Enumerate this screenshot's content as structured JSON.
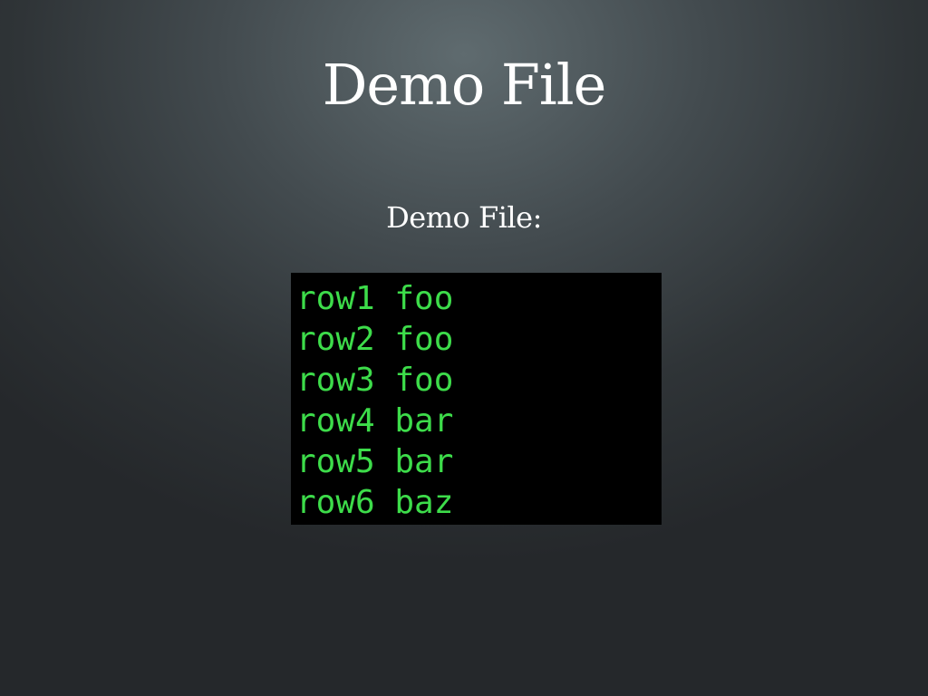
{
  "slide": {
    "title": "Demo File",
    "subtitle": "Demo File:",
    "file_rows": [
      "row1 foo",
      "row2 foo",
      "row3 foo",
      "row4 bar",
      "row5 bar",
      "row6 baz"
    ]
  },
  "colors": {
    "terminal_background": "#000000",
    "terminal_text": "#3ddc4a",
    "title_text": "#ffffff"
  }
}
